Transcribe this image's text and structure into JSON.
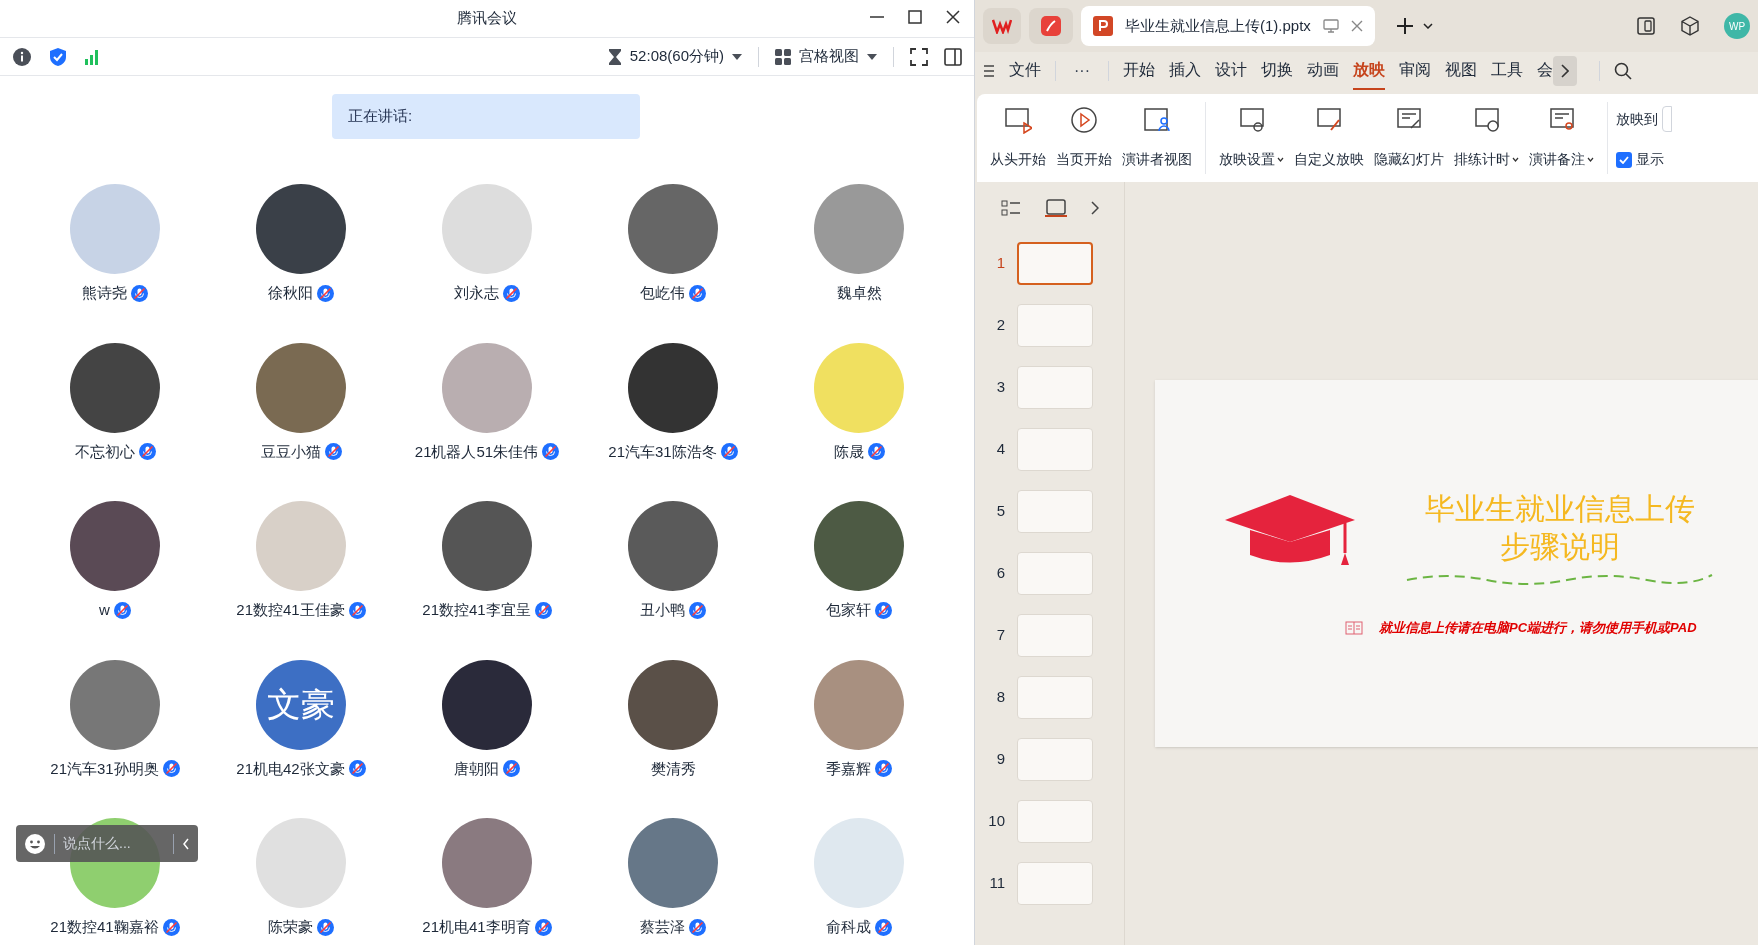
{
  "meeting": {
    "title": "腾讯会议",
    "timer": "52:08(60分钟)",
    "view": "宫格视图",
    "speaking_label": "正在讲话:",
    "participants": [
      {
        "name": "熊诗尧",
        "mic": true,
        "avatar": {
          "kind": "photo"
        }
      },
      {
        "name": "徐秋阳",
        "mic": true,
        "avatar": {
          "kind": "photo"
        }
      },
      {
        "name": "刘永志",
        "mic": true,
        "avatar": {
          "kind": "photo"
        }
      },
      {
        "name": "包屹伟",
        "mic": true,
        "avatar": {
          "kind": "photo"
        }
      },
      {
        "name": "魏卓然",
        "mic": false,
        "avatar": {
          "kind": "photo"
        }
      },
      {
        "name": "不忘初心",
        "mic": true,
        "avatar": {
          "kind": "photo"
        }
      },
      {
        "name": "豆豆小猫",
        "mic": true,
        "avatar": {
          "kind": "photo"
        }
      },
      {
        "name": "21机器人51朱佳伟",
        "mic": true,
        "avatar": {
          "kind": "photo"
        }
      },
      {
        "name": "21汽车31陈浩冬",
        "mic": true,
        "avatar": {
          "kind": "photo"
        }
      },
      {
        "name": "陈晟",
        "mic": true,
        "avatar": {
          "kind": "photo"
        }
      },
      {
        "name": "w",
        "mic": true,
        "avatar": {
          "kind": "photo"
        }
      },
      {
        "name": "21数控41王佳豪",
        "mic": true,
        "avatar": {
          "kind": "photo"
        }
      },
      {
        "name": "21数控41李宜呈",
        "mic": true,
        "avatar": {
          "kind": "photo"
        }
      },
      {
        "name": "丑小鸭",
        "mic": true,
        "avatar": {
          "kind": "photo"
        }
      },
      {
        "name": "包家轩",
        "mic": true,
        "avatar": {
          "kind": "photo"
        }
      },
      {
        "name": "21汽车31孙明奥",
        "mic": true,
        "avatar": {
          "kind": "photo"
        }
      },
      {
        "name": "21机电42张文豪",
        "mic": true,
        "avatar": {
          "kind": "text",
          "text": "文豪"
        }
      },
      {
        "name": "唐朝阳",
        "mic": true,
        "avatar": {
          "kind": "photo"
        }
      },
      {
        "name": "樊清秀",
        "mic": false,
        "avatar": {
          "kind": "photo"
        }
      },
      {
        "name": "季嘉辉",
        "mic": true,
        "avatar": {
          "kind": "photo"
        }
      },
      {
        "name": "21数控41鞠嘉裕",
        "mic": true,
        "avatar": {
          "kind": "photo"
        }
      },
      {
        "name": "陈荣豪",
        "mic": true,
        "avatar": {
          "kind": "photo"
        }
      },
      {
        "name": "21机电41李明育",
        "mic": true,
        "avatar": {
          "kind": "photo"
        }
      },
      {
        "name": "蔡芸泽",
        "mic": true,
        "avatar": {
          "kind": "photo"
        }
      },
      {
        "name": "俞科成",
        "mic": true,
        "avatar": {
          "kind": "photo"
        }
      }
    ],
    "chat": {
      "placeholder": "说点什么..."
    }
  },
  "wps": {
    "document_tab": "毕业生就业信息上传(1).pptx",
    "user_initials": "WP",
    "more": "···",
    "menu": [
      {
        "label": "文件",
        "selected": false
      },
      {
        "label": "开始",
        "selected": false
      },
      {
        "label": "插入",
        "selected": false
      },
      {
        "label": "设计",
        "selected": false
      },
      {
        "label": "切换",
        "selected": false
      },
      {
        "label": "动画",
        "selected": false
      },
      {
        "label": "放映",
        "selected": true
      },
      {
        "label": "审阅",
        "selected": false
      },
      {
        "label": "视图",
        "selected": false
      },
      {
        "label": "工具",
        "selected": false
      },
      {
        "label": "会",
        "selected": false
      }
    ],
    "ribbon_groups": [
      [
        {
          "label": "从头开始",
          "dropdown": false
        },
        {
          "label": "当页开始",
          "dropdown": false
        },
        {
          "label": "演讲者视图",
          "dropdown": false
        }
      ],
      [
        {
          "label": "放映设置",
          "dropdown": true
        },
        {
          "label": "自定义放映",
          "dropdown": false
        },
        {
          "label": "隐藏幻灯片",
          "dropdown": false
        },
        {
          "label": "排练计时",
          "dropdown": true
        },
        {
          "label": "演讲备注",
          "dropdown": true
        }
      ]
    ],
    "play_to": "放映到",
    "show_option": {
      "label": "显示",
      "checked": true
    },
    "slides": [
      {
        "number": "1",
        "selected": true
      },
      {
        "number": "2",
        "selected": false
      },
      {
        "number": "3",
        "selected": false
      },
      {
        "number": "4",
        "selected": false
      },
      {
        "number": "5",
        "selected": false
      },
      {
        "number": "6",
        "selected": false
      },
      {
        "number": "7",
        "selected": false
      },
      {
        "number": "8",
        "selected": false
      },
      {
        "number": "9",
        "selected": false
      },
      {
        "number": "10",
        "selected": false
      },
      {
        "number": "11",
        "selected": false
      }
    ],
    "slide": {
      "title_lines": [
        "毕业生就业信息上传",
        "步骤说明"
      ],
      "note": "就业信息上传请在电脑PC端进行，请勿使用手机或PAD"
    }
  }
}
